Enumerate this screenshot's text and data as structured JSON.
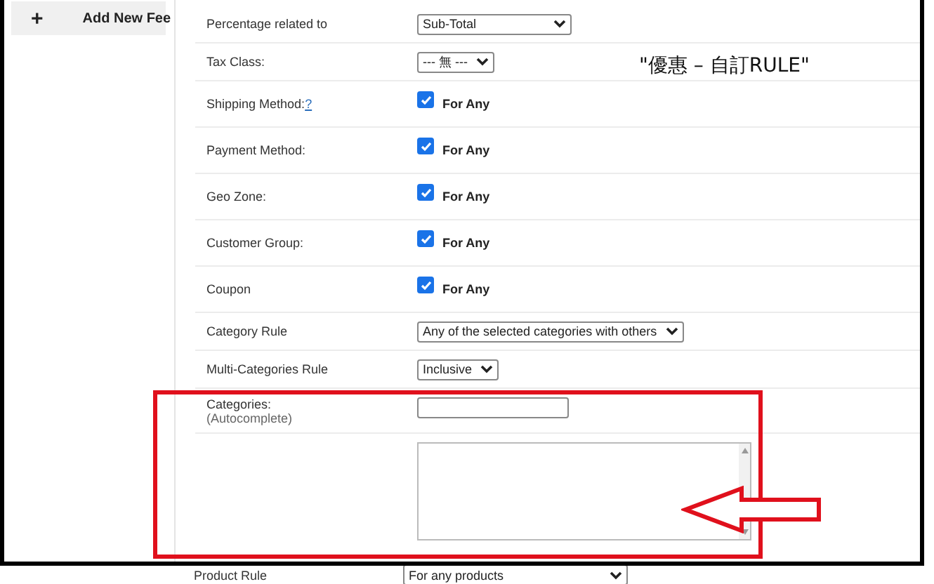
{
  "sidebar": {
    "button": {
      "icon": "+",
      "label": "Add New Fee"
    }
  },
  "annotation": {
    "text": "\"優惠 – 自訂RULE\""
  },
  "rows": [
    {
      "kind": "select",
      "label": "Percentage related to",
      "value": "Sub-Total"
    },
    {
      "kind": "select",
      "label": "Tax Class:",
      "value": "--- 無 ---"
    },
    {
      "kind": "checkbox",
      "label": "Shipping Method:",
      "help": "?",
      "checked": true,
      "option": "For Any"
    },
    {
      "kind": "checkbox",
      "label": "Payment Method:",
      "checked": true,
      "option": "For Any"
    },
    {
      "kind": "checkbox",
      "label": "Geo Zone:",
      "checked": true,
      "option": "For Any"
    },
    {
      "kind": "checkbox",
      "label": "Customer Group:",
      "checked": true,
      "option": "For Any"
    },
    {
      "kind": "checkbox",
      "label": "Coupon",
      "checked": true,
      "option": "For Any"
    },
    {
      "kind": "select",
      "label": "Category Rule",
      "value": "Any of the selected categories with others"
    },
    {
      "kind": "select",
      "label": "Multi-Categories Rule",
      "value": "Inclusive"
    },
    {
      "kind": "input",
      "label": "Categories:",
      "hint": "(Autocomplete)"
    },
    {
      "kind": "textarea"
    }
  ],
  "below": {
    "label": "Product Rule",
    "value": "For any products"
  }
}
